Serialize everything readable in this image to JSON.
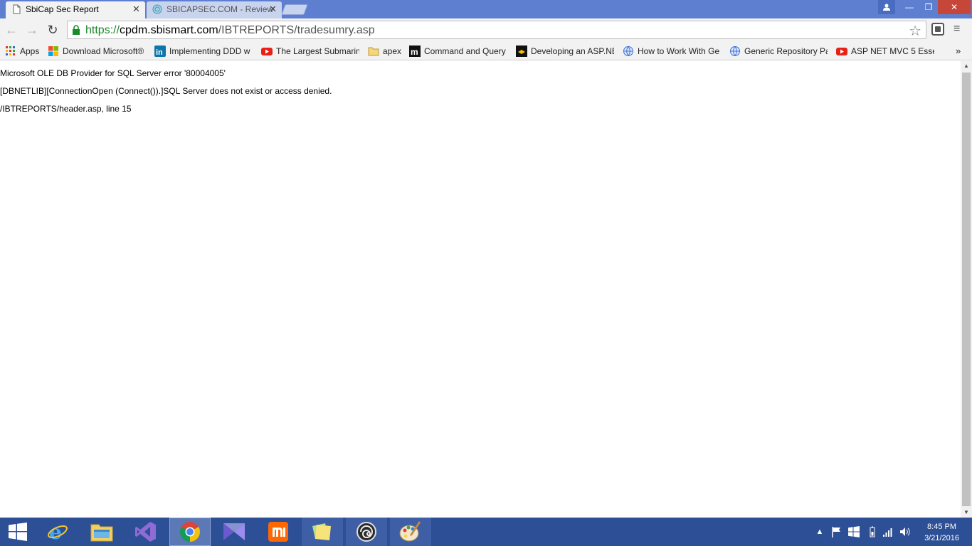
{
  "tabs": [
    {
      "title": "SbiCap Sec Report",
      "active": true
    },
    {
      "title": "SBICAPSEC.COM - Review",
      "active": false
    }
  ],
  "toolbar": {
    "url_scheme": "https://",
    "url_host": "cpdm.sbismart.com",
    "url_path": "/IBTREPORTS/tradesumry.asp"
  },
  "bookmarks": {
    "apps_label": "Apps",
    "items": [
      {
        "label": "Download Microsoft®",
        "icon": "microsoft-icon"
      },
      {
        "label": "Implementing DDD w",
        "icon": "linkedin-icon"
      },
      {
        "label": "The Largest Submarin",
        "icon": "youtube-icon"
      },
      {
        "label": "apex",
        "icon": "folder-icon"
      },
      {
        "label": "Command and Query",
        "icon": "medium-icon"
      },
      {
        "label": "Developing an ASP.NE",
        "icon": "site-icon"
      },
      {
        "label": "How to Work With Ge",
        "icon": "globe-icon"
      },
      {
        "label": "Generic Repository Pa",
        "icon": "globe-icon"
      },
      {
        "label": "ASP NET MVC 5 Essen",
        "icon": "youtube-icon"
      }
    ]
  },
  "page": {
    "line1": "Microsoft OLE DB Provider for SQL Server error '80004005'",
    "line2": "[DBNETLIB][ConnectionOpen (Connect()).]SQL Server does not exist or access denied.",
    "line3": "/IBTREPORTS/header.asp, line 15"
  },
  "taskbar": {
    "time": "8:45 PM",
    "date": "3/21/2016",
    "apps": [
      "windows-start-icon",
      "internet-explorer-icon",
      "file-explorer-icon",
      "visual-studio-icon",
      "chrome-icon",
      "visual-studio-blend-icon",
      "mi-icon",
      "sticky-notes-icon",
      "app-spiral-icon",
      "paint-icon"
    ]
  },
  "colors": {
    "tabstrip": "#5e7fcf",
    "taskbar": "#2c4f96",
    "url_green": "#1a8a2a"
  }
}
